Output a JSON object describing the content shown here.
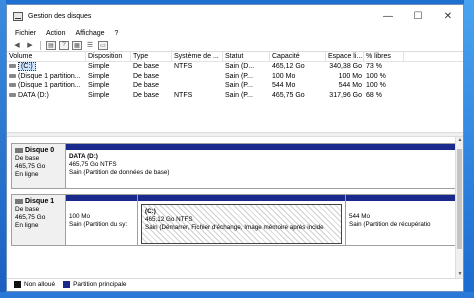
{
  "window": {
    "title": "Gestion des disques",
    "minimize_glyph": "—",
    "maximize_glyph": "☐",
    "close_glyph": "✕"
  },
  "menu": [
    "Fichier",
    "Action",
    "Affichage",
    "?"
  ],
  "toolbar": {
    "icons": [
      "back-arrow-icon",
      "forward-arrow-icon",
      "panel-icon",
      "help-icon",
      "properties-icon",
      "list-icon",
      "settings-icon"
    ]
  },
  "volumes": {
    "columns": [
      "Volume",
      "Disposition",
      "Type",
      "Système de ...",
      "Statut",
      "Capacité",
      "Espace li...",
      "% libres"
    ],
    "rows": [
      {
        "volume": "(C:)",
        "layout": "Simple",
        "type": "De base",
        "fs": "NTFS",
        "status": "Sain (D...",
        "capacity": "465,12 Go",
        "free": "340,38 Go",
        "pct": "73 %",
        "selected": true
      },
      {
        "volume": "(Disque 1 partition...",
        "layout": "Simple",
        "type": "De base",
        "fs": "",
        "status": "Sain (P...",
        "capacity": "100 Mo",
        "free": "100 Mo",
        "pct": "100 %",
        "selected": false
      },
      {
        "volume": "(Disque 1 partition...",
        "layout": "Simple",
        "type": "De base",
        "fs": "",
        "status": "Sain (P...",
        "capacity": "544 Mo",
        "free": "544 Mo",
        "pct": "100 %",
        "selected": false
      },
      {
        "volume": "DATA (D:)",
        "layout": "Simple",
        "type": "De base",
        "fs": "NTFS",
        "status": "Sain (P...",
        "capacity": "465,75 Go",
        "free": "317,96 Go",
        "pct": "68 %",
        "selected": false
      }
    ]
  },
  "disks": [
    {
      "name": "Disque 0",
      "type": "De base",
      "size": "465,75 Go",
      "state": "En ligne",
      "partitions": [
        {
          "title": "DATA (D:)",
          "size": "465,75 Go NTFS",
          "status": "Sain (Partition de données de base)",
          "hatched": false
        }
      ]
    },
    {
      "name": "Disque 1",
      "type": "De base",
      "size": "465,75 Go",
      "state": "En ligne",
      "partitions": [
        {
          "title": "",
          "size": "100 Mo",
          "status": "Sain (Partition du sy:",
          "hatched": false
        },
        {
          "title": "(C:)",
          "size": "465,12 Go NTFS",
          "status": "Sain (Démarrer, Fichier d'échange, Image mémoire après incide",
          "hatched": true
        },
        {
          "title": "",
          "size": "544 Mo",
          "status": "Sain (Partition de récupératio",
          "hatched": false
        }
      ]
    }
  ],
  "legend": [
    {
      "label": "Non alloué",
      "color": "#111111"
    },
    {
      "label": "Partition principale",
      "color": "#1a2a8c"
    }
  ]
}
